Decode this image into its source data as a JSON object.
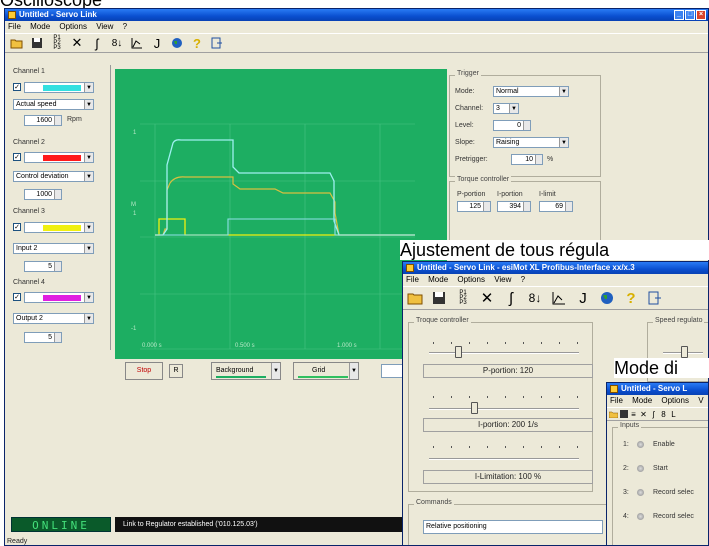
{
  "headings": {
    "top": "Oscilloscope",
    "middle": "Ajustement de tous régula",
    "right": "Mode di"
  },
  "window1": {
    "title": "Untitled - Servo Link",
    "menu": [
      "File",
      "Mode",
      "Options",
      "View",
      "?"
    ],
    "channels": [
      {
        "label": "Channel 1",
        "checked": "✓",
        "color": "#33e0e0",
        "signal": "Actual speed",
        "value": "1600",
        "unit": "Rpm"
      },
      {
        "label": "Channel 2",
        "checked": "✓",
        "color": "#ff1a1a",
        "signal": "Control deviation",
        "value": "1000",
        "unit": ""
      },
      {
        "label": "Channel 3",
        "checked": "✓",
        "color": "#f0f010",
        "signal": "Input 2",
        "value": "5",
        "unit": ""
      },
      {
        "label": "Channel 4",
        "checked": "✓",
        "color": "#e020e0",
        "signal": "Output 2",
        "value": "5",
        "unit": ""
      }
    ],
    "scope": {
      "background": "#1dae62",
      "x_ticks": [
        "0.000 s",
        "0.500 s",
        "1.000 s"
      ],
      "y_marks": [
        "1",
        "M",
        "1",
        "-1"
      ]
    },
    "trigger": {
      "group": "Trigger",
      "mode_label": "Mode:",
      "mode": "Normal",
      "channel_label": "Channel:",
      "channel": "3",
      "level_label": "Level:",
      "level": "0",
      "slope_label": "Slope:",
      "slope": "Raising",
      "pretrigger_label": "Pretrigger:",
      "pretrigger": "10",
      "pretrigger_unit": "%"
    },
    "torque": {
      "group": "Torque controller",
      "headers": [
        "P-portion",
        "I-portion",
        "I-limit"
      ],
      "values": [
        "125",
        "394",
        "69"
      ]
    },
    "buttons": {
      "stop": "Stop",
      "r": "R",
      "background": "Background",
      "grid": "Grid"
    },
    "status": {
      "online": "ONLINE",
      "message": "Link to Regulator established ('010.125.03')",
      "ready": "Ready"
    }
  },
  "window2": {
    "title": "Untitled - Servo Link - esiMot XL Profibus-Interface xx/x.3",
    "menu": [
      "File",
      "Mode",
      "Options",
      "View",
      "?"
    ],
    "torque_group": "Troque controller",
    "speed_group": "Speed regulato",
    "p_portion": "P-portion: 120",
    "i_portion": "I-portion: 200 1/s",
    "i_limitation": "I-Limitation: 100 %",
    "commands_group": "Commands",
    "command_value": "Relative positioning"
  },
  "window3": {
    "title": "Untitled - Servo L",
    "menu": [
      "File",
      "Mode",
      "Options",
      "V"
    ],
    "inputs_group": "Inputs",
    "inputs": [
      {
        "num": "1:",
        "label": "Enable"
      },
      {
        "num": "2:",
        "label": "Start"
      },
      {
        "num": "3:",
        "label": "Record selec"
      },
      {
        "num": "4:",
        "label": "Record selec"
      }
    ]
  },
  "icons": [
    "open-folder-icon",
    "save-icon",
    "parameter-list-icon",
    "tools-icon",
    "curve-icon",
    "settings-icon",
    "graph-icon",
    "tune-icon",
    "globe-icon",
    "help-icon",
    "exit-icon"
  ]
}
